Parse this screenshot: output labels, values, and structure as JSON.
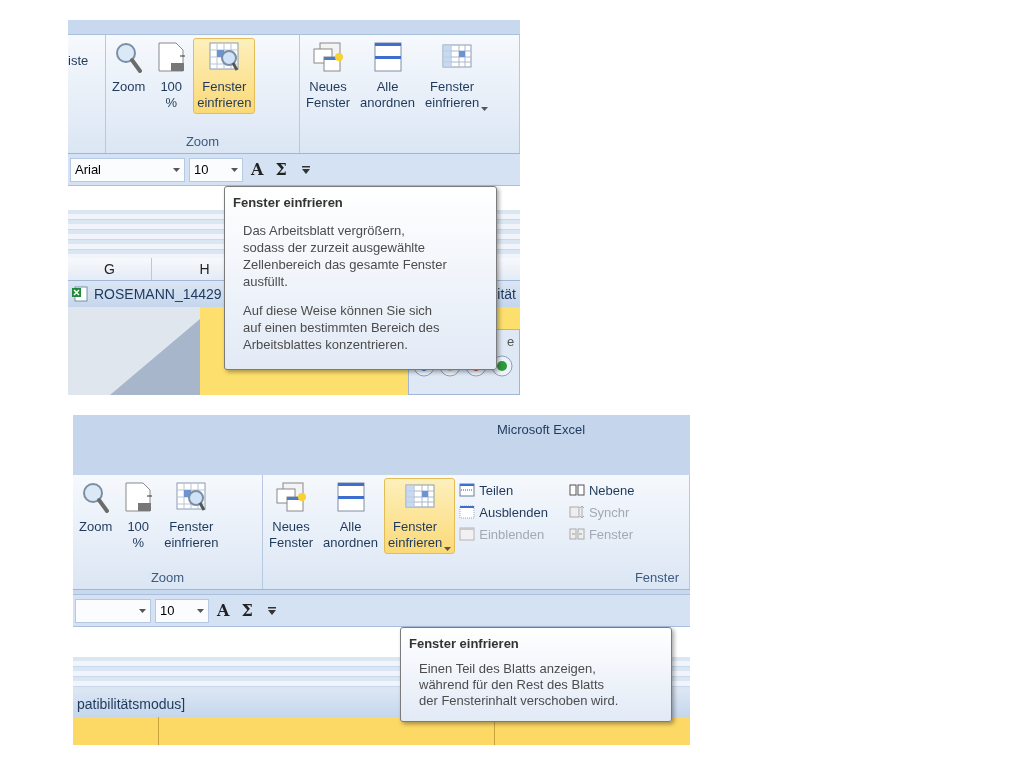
{
  "screenshot_1": {
    "ribbon_fragment": "iste",
    "ribbon_groups": [
      {
        "label": "Zoom",
        "buttons": [
          {
            "label": "Zoom",
            "selected": false,
            "dropdown": false
          },
          {
            "label": "100\n%",
            "selected": false,
            "dropdown": false
          },
          {
            "label": "Fenster\neinfrieren",
            "selected": true,
            "dropdown": false
          }
        ]
      },
      {
        "buttons": [
          {
            "label": "Neues\nFenster",
            "selected": false,
            "dropdown": false
          },
          {
            "label": "Alle\nanordnen",
            "selected": false,
            "dropdown": false
          },
          {
            "label": "Fenster\neinfrieren",
            "selected": false,
            "dropdown": true
          }
        ]
      }
    ],
    "toolbar": {
      "font": "Arial",
      "size": "10",
      "grow_font": "A",
      "sum": "Σ"
    },
    "column_headers": [
      "G",
      "H"
    ],
    "document_title": "ROSEMANN_14429",
    "document_title_fragment": "ität",
    "side_pane_text": "e",
    "tooltip": {
      "title": "Fenster einfrieren",
      "paragraphs": [
        "Das Arbeitsblatt vergrößern,\nsodass der zurzeit ausgewählte\nZellenbereich das gesamte Fenster\nausfüllt.",
        "Auf diese Weise können Sie sich\nauf einen bestimmten Bereich des\nArbeitsblattes konzentrieren."
      ]
    }
  },
  "screenshot_2": {
    "window_title": "Microsoft Excel",
    "ribbon_groups": [
      {
        "label": "Zoom",
        "buttons": [
          {
            "label": "Zoom",
            "selected": false,
            "dropdown": false
          },
          {
            "label": "100\n%",
            "selected": false,
            "dropdown": false
          },
          {
            "label": "Fenster\neinfrieren",
            "selected": false,
            "dropdown": false
          }
        ]
      },
      {
        "label": "Fenster",
        "buttons": [
          {
            "label": "Neues\nFenster",
            "selected": false,
            "dropdown": false
          },
          {
            "label": "Alle\nanordnen",
            "selected": false,
            "dropdown": false
          },
          {
            "label": "Fenster\neinfrieren",
            "selected": true,
            "dropdown": true
          }
        ],
        "small_buttons": [
          {
            "label": "Teilen",
            "disabled": false
          },
          {
            "label": "Ausblenden",
            "disabled": false
          },
          {
            "label": "Einblenden",
            "disabled": true
          }
        ],
        "small_buttons_2": [
          {
            "label": "Nebene",
            "disabled": false
          },
          {
            "label": "Synchr",
            "disabled": true
          },
          {
            "label": "Fenster",
            "disabled": true
          }
        ]
      }
    ],
    "toolbar": {
      "size": "10",
      "grow_font": "A",
      "sum": "Σ"
    },
    "document_title": "patibilitätsmodus]",
    "tooltip": {
      "title": "Fenster einfrieren",
      "paragraphs": [
        "Einen Teil des Blatts anzeigen,\nwährend für den Rest des Blatts\nder Fensterinhalt verschoben wird."
      ]
    }
  }
}
